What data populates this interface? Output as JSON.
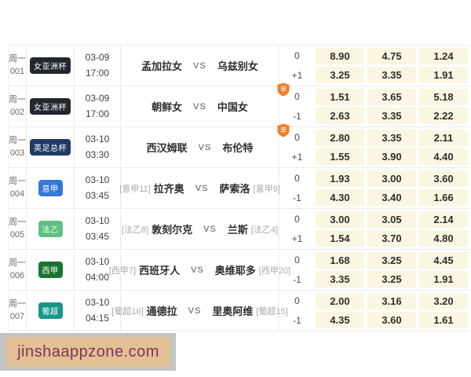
{
  "labels": {
    "vs": "VS",
    "single_badge_glyph": "单"
  },
  "colors": {
    "odds_cell_bg": "#faf6e1",
    "single_badge": "#ef7d25",
    "row_border": "#e9ebf0",
    "watermark_bg": "#e3c095",
    "watermark_frame": "#c3c3c3",
    "watermark_text_color": "#7d3657"
  },
  "watermark": {
    "text": "jinshaappzone.com"
  },
  "matches": [
    {
      "id_line1": "周一",
      "id_line2": "001",
      "league": {
        "label": "女亚洲杯",
        "color": "#22262d"
      },
      "date": "03-09",
      "time": "17:00",
      "home_rank": "",
      "home": "孟加拉女",
      "away": "乌兹别女",
      "away_rank": "",
      "single_badge": false,
      "lines": [
        {
          "handicap": "0",
          "odds": [
            "8.90",
            "4.75",
            "1.24"
          ]
        },
        {
          "handicap": "+1",
          "odds": [
            "3.25",
            "3.35",
            "1.91"
          ]
        }
      ]
    },
    {
      "id_line1": "周一",
      "id_line2": "002",
      "league": {
        "label": "女亚洲杯",
        "color": "#22262d"
      },
      "date": "03-09",
      "time": "17:00",
      "home_rank": "",
      "home": "朝鲜女",
      "away": "中国女",
      "away_rank": "",
      "single_badge": true,
      "lines": [
        {
          "handicap": "0",
          "odds": [
            "1.51",
            "3.65",
            "5.18"
          ]
        },
        {
          "handicap": "-1",
          "odds": [
            "2.63",
            "3.35",
            "2.22"
          ]
        }
      ]
    },
    {
      "id_line1": "周一",
      "id_line2": "003",
      "league": {
        "label": "英足总杯",
        "color": "#203a64"
      },
      "date": "03-10",
      "time": "03:30",
      "home_rank": "",
      "home": "西汉姆联",
      "away": "布伦特",
      "away_rank": "",
      "single_badge": true,
      "lines": [
        {
          "handicap": "0",
          "odds": [
            "2.80",
            "3.35",
            "2.11"
          ]
        },
        {
          "handicap": "+1",
          "odds": [
            "1.55",
            "3.90",
            "4.40"
          ]
        }
      ]
    },
    {
      "id_line1": "周一",
      "id_line2": "004",
      "league": {
        "label": "意甲",
        "color": "#3577db"
      },
      "date": "03-10",
      "time": "03:45",
      "home_rank": "[意甲11]",
      "home": "拉齐奥",
      "away": "萨索洛",
      "away_rank": "[意甲9]",
      "single_badge": false,
      "lines": [
        {
          "handicap": "0",
          "odds": [
            "1.93",
            "3.00",
            "3.60"
          ]
        },
        {
          "handicap": "-1",
          "odds": [
            "4.30",
            "3.40",
            "1.66"
          ]
        }
      ]
    },
    {
      "id_line1": "周一",
      "id_line2": "005",
      "league": {
        "label": "法乙",
        "color": "#5fc080"
      },
      "date": "03-10",
      "time": "03:45",
      "home_rank": "[法乙8]",
      "home": "敦刻尔克",
      "away": "兰斯",
      "away_rank": "[法乙4]",
      "single_badge": false,
      "lines": [
        {
          "handicap": "0",
          "odds": [
            "3.00",
            "3.05",
            "2.14"
          ]
        },
        {
          "handicap": "+1",
          "odds": [
            "1.54",
            "3.70",
            "4.80"
          ]
        }
      ]
    },
    {
      "id_line1": "周一",
      "id_line2": "006",
      "league": {
        "label": "西甲",
        "color": "#1a7430"
      },
      "date": "03-10",
      "time": "04:00",
      "home_rank": "[西甲7]",
      "home": "西班牙人",
      "away": "奥维耶多",
      "away_rank": "[西甲20]",
      "single_badge": false,
      "lines": [
        {
          "handicap": "0",
          "odds": [
            "1.68",
            "3.25",
            "4.45"
          ]
        },
        {
          "handicap": "-1",
          "odds": [
            "3.35",
            "3.25",
            "1.91"
          ]
        }
      ]
    },
    {
      "id_line1": "周一",
      "id_line2": "007",
      "league": {
        "label": "葡超",
        "color": "#16968b"
      },
      "date": "03-10",
      "time": "04:15",
      "home_rank": "[葡超16]",
      "home": "通德拉",
      "away": "里奥阿维",
      "away_rank": "[葡超15]",
      "single_badge": false,
      "lines": [
        {
          "handicap": "0",
          "odds": [
            "2.00",
            "3.16",
            "3.20"
          ]
        },
        {
          "handicap": "-1",
          "odds": [
            "4.35",
            "3.60",
            "1.61"
          ]
        }
      ]
    }
  ]
}
